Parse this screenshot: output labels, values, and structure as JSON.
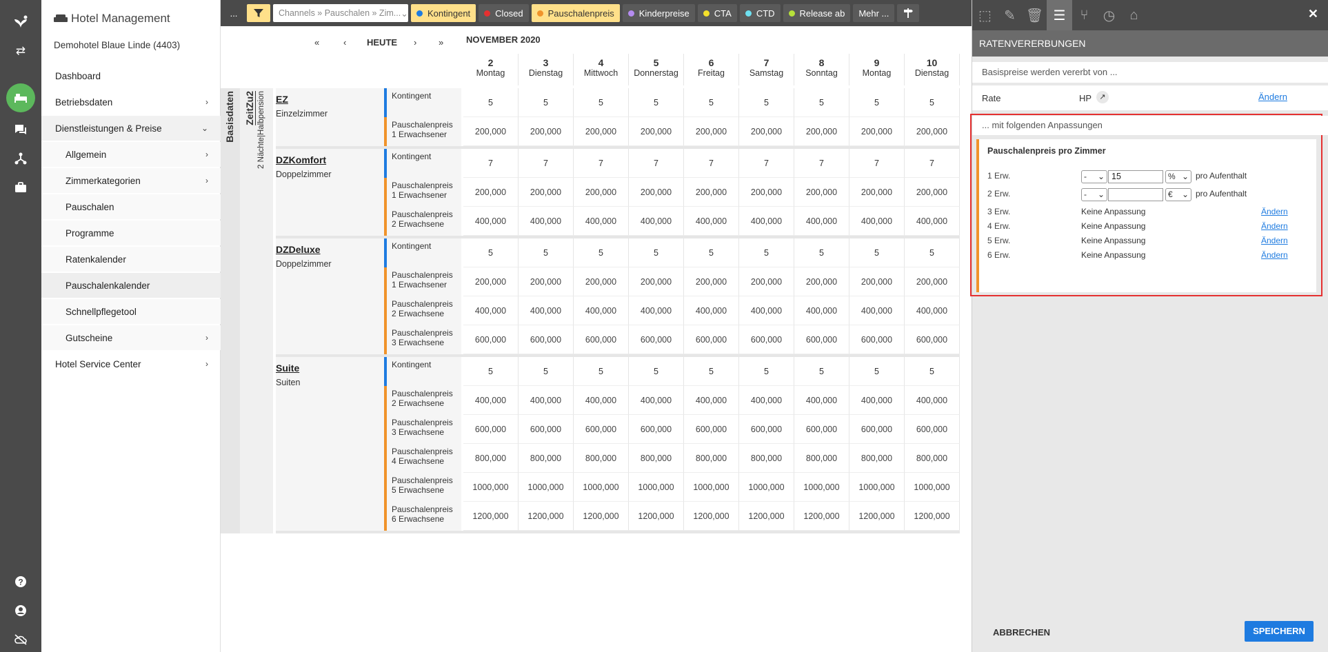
{
  "app": {
    "title": "Hotel Management",
    "hotel": "Demohotel Blaue Linde (4403)"
  },
  "rail_icons": [
    "bees-logo-icon",
    "swap-icon",
    "bed-icon",
    "chat-icon",
    "network-icon",
    "briefcase-icon",
    "help-icon",
    "user-icon",
    "cloud-off-icon"
  ],
  "nav": {
    "dashboard": "Dashboard",
    "betriebsdaten": "Betriebsdaten",
    "dienstleistungen": "Dienstleistungen & Preise",
    "allgemein": "Allgemein",
    "zimmerkategorien": "Zimmerkategorien",
    "pauschalen": "Pauschalen",
    "programme": "Programme",
    "ratenkalender": "Ratenkalender",
    "pauschalenkalender": "Pauschalenkalender",
    "schnellpflegetool": "Schnellpflegetool",
    "gutscheine": "Gutscheine",
    "hotel_service_center": "Hotel Service Center"
  },
  "toolbar": {
    "more": "...",
    "channel_select": "Channels » Pauschalen » Zim...",
    "tags": [
      {
        "label": "Kontingent",
        "color": "#1e7be0",
        "active": true
      },
      {
        "label": "Closed",
        "color": "#e53030",
        "active": false
      },
      {
        "label": "Pauschalenpreis",
        "color": "#f0932b",
        "active": true
      },
      {
        "label": "Kinderpreise",
        "color": "#b58cf0",
        "active": false
      },
      {
        "label": "CTA",
        "color": "#f5e02b",
        "active": false
      },
      {
        "label": "CTD",
        "color": "#6ee0f0",
        "active": false
      },
      {
        "label": "Release ab",
        "color": "#b6e03a",
        "active": false
      }
    ],
    "mehr": "Mehr ..."
  },
  "calendar": {
    "today": "HEUTE",
    "month": "NOVEMBER 2020",
    "days": [
      {
        "n": "2",
        "w": "Montag"
      },
      {
        "n": "3",
        "w": "Dienstag"
      },
      {
        "n": "4",
        "w": "Mittwoch"
      },
      {
        "n": "5",
        "w": "Donnerstag"
      },
      {
        "n": "6",
        "w": "Freitag"
      },
      {
        "n": "7",
        "w": "Samstag"
      },
      {
        "n": "8",
        "w": "Sonntag"
      },
      {
        "n": "9",
        "w": "Montag"
      },
      {
        "n": "10",
        "w": "Dienstag"
      }
    ],
    "side_label": "Basisdaten",
    "package_name": "ZeitZu2",
    "package_desc": "2 Nächte|Halbpension",
    "rooms": [
      {
        "code": "EZ",
        "name": "Einzelzimmer",
        "rows": [
          {
            "type": "k",
            "l1": "Kontingent",
            "l2": "",
            "v": "5"
          },
          {
            "type": "p",
            "l1": "Pauschalenpreis",
            "l2": "1 Erwachsener",
            "v": "200,000"
          }
        ]
      },
      {
        "code": "DZKomfort",
        "name": "Doppelzimmer",
        "rows": [
          {
            "type": "k",
            "l1": "Kontingent",
            "l2": "",
            "v": "7"
          },
          {
            "type": "p",
            "l1": "Pauschalenpreis",
            "l2": "1 Erwachsener",
            "v": "200,000"
          },
          {
            "type": "p",
            "l1": "Pauschalenpreis",
            "l2": "2 Erwachsene",
            "v": "400,000"
          }
        ]
      },
      {
        "code": "DZDeluxe",
        "name": "Doppelzimmer",
        "rows": [
          {
            "type": "k",
            "l1": "Kontingent",
            "l2": "",
            "v": "5"
          },
          {
            "type": "p",
            "l1": "Pauschalenpreis",
            "l2": "1 Erwachsener",
            "v": "200,000"
          },
          {
            "type": "p",
            "l1": "Pauschalenpreis",
            "l2": "2 Erwachsene",
            "v": "400,000"
          },
          {
            "type": "p",
            "l1": "Pauschalenpreis",
            "l2": "3 Erwachsene",
            "v": "600,000"
          }
        ]
      },
      {
        "code": "Suite",
        "name": "Suiten",
        "rows": [
          {
            "type": "k",
            "l1": "Kontingent",
            "l2": "",
            "v": "5"
          },
          {
            "type": "p",
            "l1": "Pauschalenpreis",
            "l2": "2 Erwachsene",
            "v": "400,000"
          },
          {
            "type": "p",
            "l1": "Pauschalenpreis",
            "l2": "3 Erwachsene",
            "v": "600,000"
          },
          {
            "type": "p",
            "l1": "Pauschalenpreis",
            "l2": "4 Erwachsene",
            "v": "800,000"
          },
          {
            "type": "p",
            "l1": "Pauschalenpreis",
            "l2": "5 Erwachsene",
            "v": "1000,000"
          },
          {
            "type": "p",
            "l1": "Pauschalenpreis",
            "l2": "6 Erwachsene",
            "v": "1200,000"
          }
        ]
      }
    ]
  },
  "panel": {
    "tab_icons": [
      "select-icon",
      "pencil-icon",
      "trash-icon",
      "sliders-icon",
      "inherit-icon",
      "history-icon",
      "basket-icon"
    ],
    "title": "RATENVERERBUNGEN",
    "inherit_text": "Basispreise werden vererbt von ...",
    "rate_label": "Rate",
    "rate_value": "HP",
    "change": "Ändern",
    "adjust_text": "... mit folgenden Anpassungen",
    "adjust_title": "Pauschalenpreis pro Zimmer",
    "rows": [
      {
        "label": "1 Erw.",
        "op": "-",
        "value": "15",
        "unit": "%",
        "suffix": "pro Aufenthalt"
      },
      {
        "label": "2 Erw.",
        "op": "-",
        "value": "",
        "unit": "€",
        "suffix": "pro Aufenthalt"
      }
    ],
    "none_rows": [
      {
        "label": "3 Erw.",
        "text": "Keine Anpassung"
      },
      {
        "label": "4 Erw.",
        "text": "Keine Anpassung"
      },
      {
        "label": "5 Erw.",
        "text": "Keine Anpassung"
      },
      {
        "label": "6 Erw.",
        "text": "Keine Anpassung"
      }
    ],
    "cancel": "ABBRECHEN",
    "save": "SPEICHERN"
  }
}
